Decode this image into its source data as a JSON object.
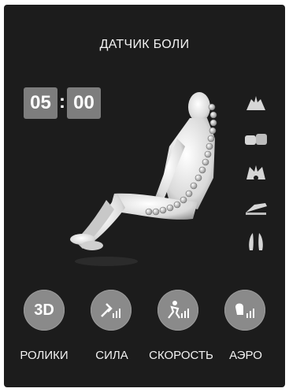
{
  "header": {
    "title": "ДАТЧИК БОЛИ"
  },
  "timer": {
    "minutes": "05",
    "separator": ":",
    "seconds": "00"
  },
  "side_icons": [
    {
      "icon": "hands-pressing-icon"
    },
    {
      "icon": "hands-clapping-icon"
    },
    {
      "icon": "hands-kneading-icon"
    },
    {
      "icon": "hand-rubbing-icon"
    },
    {
      "icon": "hands-pair-icon"
    }
  ],
  "controls": {
    "rollers": {
      "icon_text": "3D",
      "label": "РОЛИКИ"
    },
    "strength": {
      "icon": "strength-signal-icon",
      "label": "СИЛА"
    },
    "speed": {
      "icon": "speed-signal-icon",
      "label": "СКОРОСТЬ"
    },
    "aero": {
      "icon": "aero-signal-icon",
      "label": "АЭРО"
    }
  },
  "colors": {
    "background": "#1c1c1c",
    "button": "#8a8a8a",
    "timer_box": "#7d7d7d",
    "text": "#f2f2f2"
  }
}
